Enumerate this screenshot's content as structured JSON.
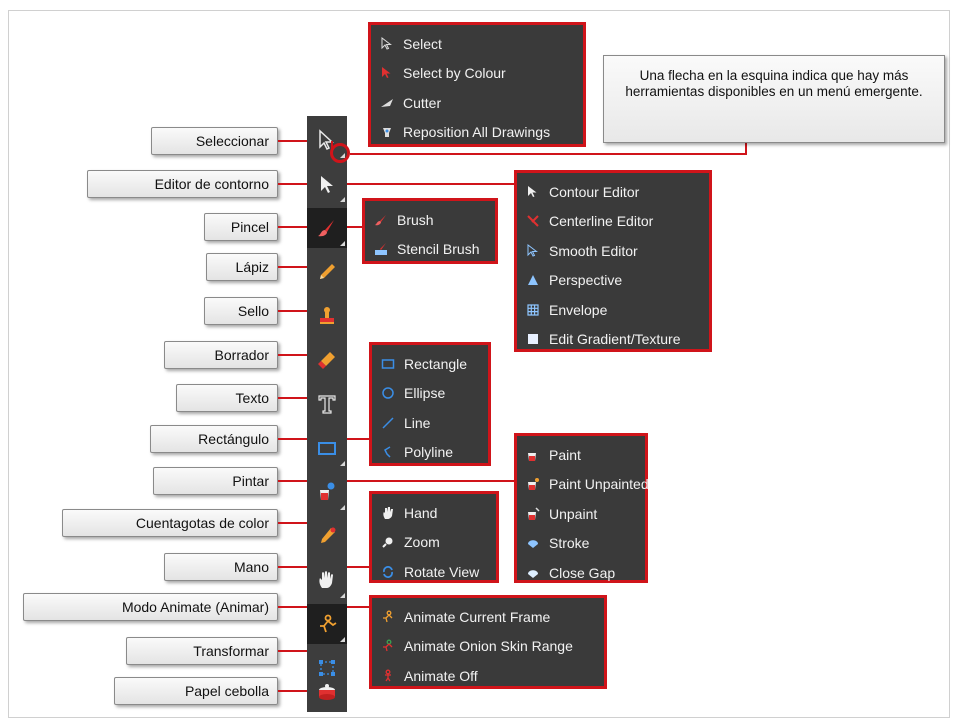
{
  "labels": {
    "seleccionar": "Seleccionar",
    "editor": "Editor de contorno",
    "pincel": "Pincel",
    "lapiz": "Lápiz",
    "sello": "Sello",
    "borrador": "Borrador",
    "texto": "Texto",
    "rectangulo": "Rectángulo",
    "pintar": "Pintar",
    "cuentagotas": "Cuentagotas de color",
    "mano": "Mano",
    "animate": "Modo Animate (Animar)",
    "transformar": "Transformar",
    "papel": "Papel cebolla"
  },
  "note": "Una flecha en la esquina indica que hay más herramientas disponibles en un menú emergente.",
  "menus": {
    "select": [
      "Select",
      "Select by Colour",
      "Cutter",
      "Reposition All Drawings"
    ],
    "contour": [
      "Contour Editor",
      "Centerline Editor",
      "Smooth Editor",
      "Perspective",
      "Envelope",
      "Edit Gradient/Texture"
    ],
    "brush": [
      "Brush",
      "Stencil Brush"
    ],
    "shapes": [
      "Rectangle",
      "Ellipse",
      "Line",
      "Polyline"
    ],
    "paint": [
      "Paint",
      "Paint Unpainted",
      "Unpaint",
      "Stroke",
      "Close Gap"
    ],
    "hand": [
      "Hand",
      "Zoom",
      "Rotate View"
    ],
    "animate": [
      "Animate Current Frame",
      "Animate Onion Skin Range",
      "Animate Off"
    ]
  },
  "colors": {
    "accent": "#d0141a",
    "toolbar": "#3d3d3d",
    "menu": "#3a3a3a"
  }
}
